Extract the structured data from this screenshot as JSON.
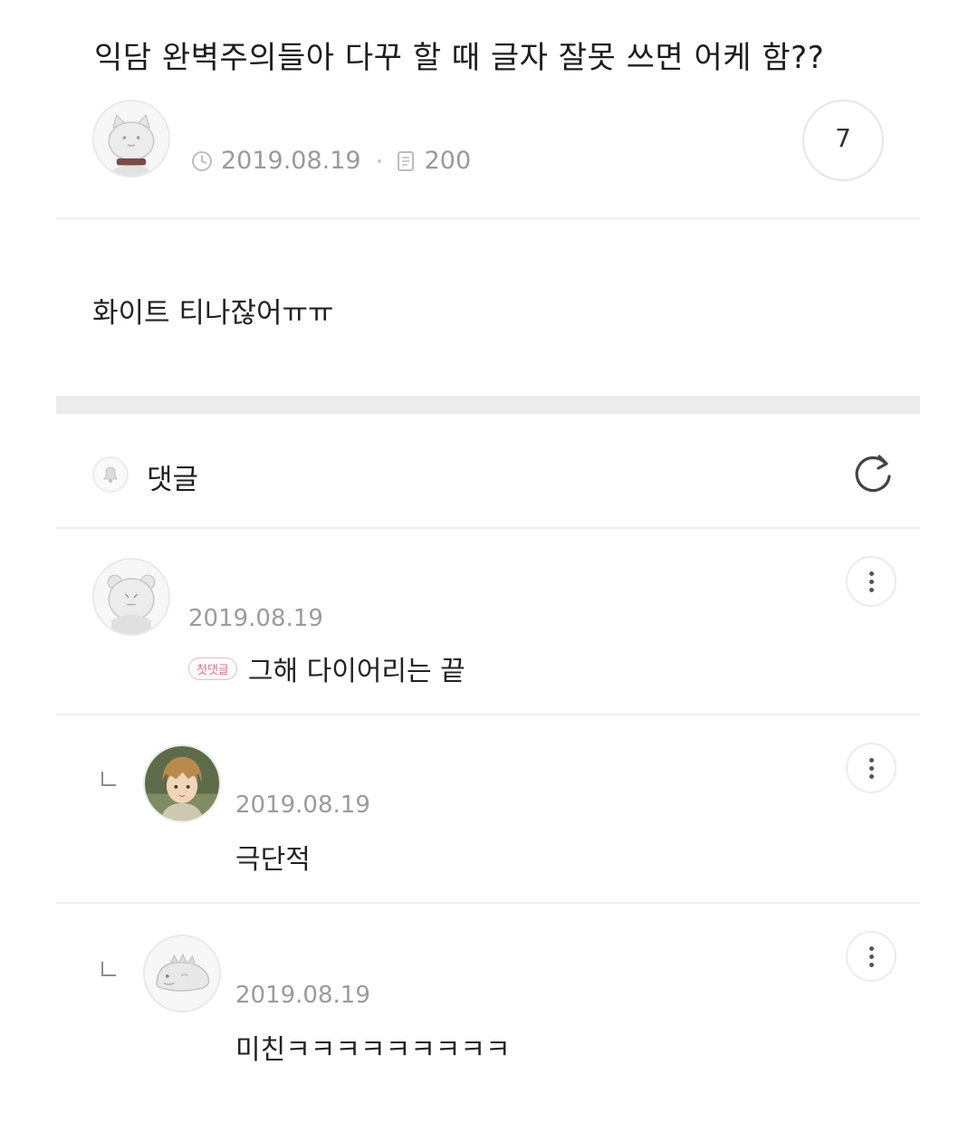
{
  "post": {
    "title": "익담 완벽주의들아 다꾸 할 때 글자 잘못 쓰면 어케 함??",
    "date": "2019.08.19",
    "views": "200",
    "comment_count": "7",
    "body": "화이트 티나잖어ㅠㅠ",
    "icons": {
      "avatar": "cat-avatar-icon",
      "date": "clock-icon",
      "views": "document-icon"
    }
  },
  "comments_section": {
    "label": "댓글",
    "icons": {
      "header": "bell-icon",
      "refresh": "refresh-icon"
    }
  },
  "comments": [
    {
      "date": "2019.08.19",
      "badge": "첫댓글",
      "text": "그해 다이어리는 끝",
      "is_reply": false,
      "avatar": "bear-avatar-icon"
    },
    {
      "date": "2019.08.19",
      "text": "극단적",
      "is_reply": true,
      "avatar": "anime-boy-avatar-icon"
    },
    {
      "date": "2019.08.19",
      "text": "미친ㅋㅋㅋㅋㅋㅋㅋㅋㅋ",
      "is_reply": true,
      "avatar": "dinosaur-avatar-icon"
    }
  ],
  "colors": {
    "divider": "#efefef",
    "band": "#ececec",
    "meta_text": "#9a9a9a",
    "badge_pink": "#e26a8e"
  }
}
